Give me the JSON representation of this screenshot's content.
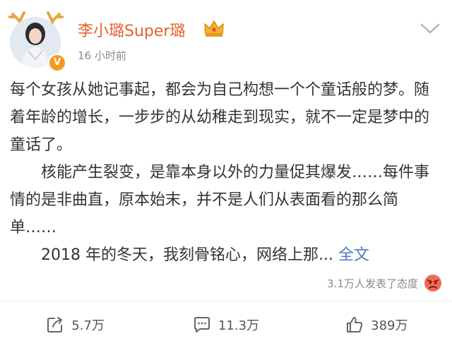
{
  "post": {
    "username": "李小璐Super璐",
    "time": "16 小时前",
    "paragraphs": [
      "每个女孩从她记事起，都会为自己构想一个个童话般的梦。随着年龄的增长，一步步的从幼稚走到现实，就不一定是梦中的童话了。",
      "核能产生裂变，是靠本身以外的力量促其爆发……每件事情的是非曲直，原本始末，并不是人们从表面看的那么简单……",
      "2018 年的冬天，我刻骨铭心，网络上那..."
    ],
    "full_text_link": "全文",
    "reaction_text": "3.1万人发表了态度"
  },
  "actions": {
    "repost_count": "5.7万",
    "comment_count": "11.3万",
    "like_count": "389万"
  },
  "icons": [
    "antler-icon",
    "vip-badge-icon",
    "crown-icon",
    "chevron-down-icon",
    "angry-emoji-icon",
    "repost-icon",
    "comment-icon",
    "like-icon"
  ],
  "colors": {
    "username": "#e4612d",
    "link": "#4d7ebb",
    "muted": "#8a8a8a",
    "badge": "#f39a1e"
  }
}
